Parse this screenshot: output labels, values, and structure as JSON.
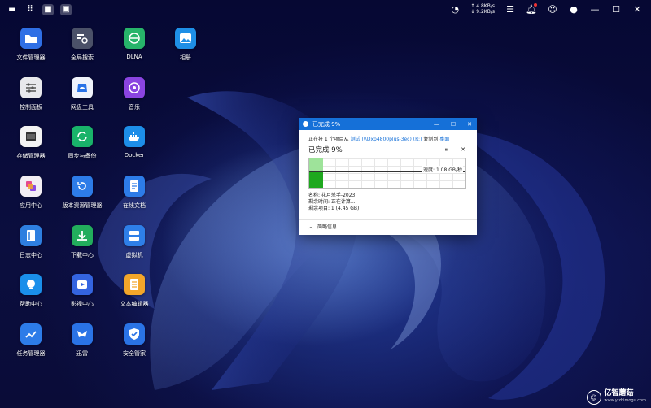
{
  "colors": {
    "titlebar": "#1570d8",
    "progress_light": "#9ee39a",
    "progress_dark": "#1ea81e"
  },
  "topbar": {
    "speed_up": "↑ 4.8KB/s",
    "speed_down": "↓ 9.2KB/s",
    "left_icons": [
      "menu-icon",
      "grid-icon",
      "folder-icon",
      "window-icon"
    ],
    "right_icons": [
      "dashboard-icon",
      "task-list-icon",
      "bell-icon",
      "user-icon",
      "power-icon"
    ],
    "window_controls": [
      "—",
      "☐",
      "✕"
    ]
  },
  "apps": [
    {
      "label": "文件管理器",
      "icon": "folder-icon",
      "color": "#2f6fe5"
    },
    {
      "label": "全局搜索",
      "icon": "search-icon",
      "color": "#4b5168"
    },
    {
      "label": "DLNA",
      "icon": "dlna-icon",
      "color": "#27b46a"
    },
    {
      "label": "相册",
      "icon": "photo-icon",
      "color": "#1e8fe6"
    },
    {
      "label": "控制面板",
      "icon": "sliders-icon",
      "color": "#e8e8ec"
    },
    {
      "label": "网盘工具",
      "icon": "cloud-icon",
      "color": "#f0f3fb"
    },
    {
      "label": "音乐",
      "icon": "music-icon",
      "color": "#8a44e0"
    },
    {
      "label": "存储管理器",
      "icon": "storage-icon",
      "color": "#f3f3f3"
    },
    {
      "label": "同步与备份",
      "icon": "sync-icon",
      "color": "#19b36a"
    },
    {
      "label": "Docker",
      "icon": "docker-icon",
      "color": "#1d8ee8"
    },
    {
      "label": "应用中心",
      "icon": "apps-icon",
      "color": "#f2eef4"
    },
    {
      "label": "版本资源管理器",
      "icon": "version-icon",
      "color": "#2d7ce8"
    },
    {
      "label": "在线文档",
      "icon": "document-icon",
      "color": "#2d7ce8"
    },
    {
      "label": "日志中心",
      "icon": "log-icon",
      "color": "#2e7fe0"
    },
    {
      "label": "下载中心",
      "icon": "download-icon",
      "color": "#22ad5c"
    },
    {
      "label": "虚拟机",
      "icon": "vm-icon",
      "color": "#2e7fe8"
    },
    {
      "label": "帮助中心",
      "icon": "help-icon",
      "color": "#1a8fea"
    },
    {
      "label": "影视中心",
      "icon": "video-icon",
      "color": "#3464e0"
    },
    {
      "label": "文本编辑器",
      "icon": "text-editor-icon",
      "color": "#f3a62a"
    },
    {
      "label": "任务管理器",
      "icon": "task-manager-icon",
      "color": "#2d7ce8"
    },
    {
      "label": "迅雷",
      "icon": "thunder-icon",
      "color": "#2a73e6"
    },
    {
      "label": "安全管家",
      "icon": "shield-icon",
      "color": "#2a73e6"
    }
  ],
  "dialog": {
    "title": "已完成 9%",
    "line_prefix": "正在将 1 个项目从",
    "source": "测试 (\\\\Dxp4800plus-3ec) (R:)",
    "copy_to": "复制到",
    "dest": "桌面",
    "done": "已完成 9%",
    "progress": 0.09,
    "pause": "⏸",
    "close": "✕",
    "speed": "速度: 1.08 GB/秒",
    "name": "名称: 花月杀手-2023",
    "time_left": "剩余时间: 正在计算...",
    "items_left": "剩余项目: 1 (4.45 GB)",
    "less_info": "简略信息"
  },
  "watermark": {
    "main": "亿智蘑菇",
    "sub": "www.yizhimogu.com"
  }
}
